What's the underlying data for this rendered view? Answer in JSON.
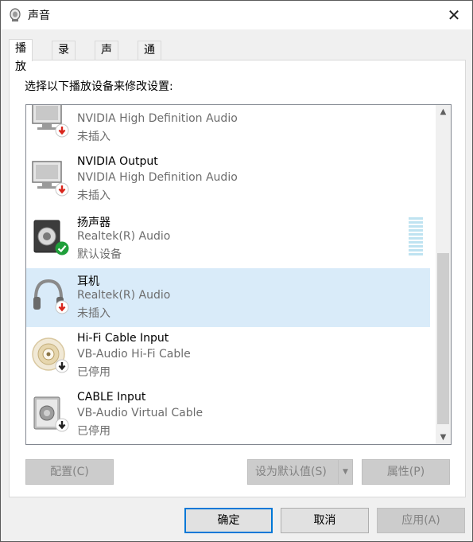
{
  "window": {
    "title": "声音",
    "close_glyph": "✕"
  },
  "tabs": [
    {
      "label": "播放",
      "active": true
    },
    {
      "label": "录制",
      "active": false
    },
    {
      "label": "声音",
      "active": false
    },
    {
      "label": "通信",
      "active": false
    }
  ],
  "playback": {
    "instruction": "选择以下播放设备来修改设置:",
    "devices": [
      {
        "name": "",
        "description": "NVIDIA High Definition Audio",
        "status": "未插入",
        "icon": "monitor-icon",
        "badge": "unplugged-red-arrow",
        "selected": false
      },
      {
        "name": "NVIDIA Output",
        "description": "NVIDIA High Definition Audio",
        "status": "未插入",
        "icon": "monitor-icon",
        "badge": "unplugged-red-arrow",
        "selected": false
      },
      {
        "name": "扬声器",
        "description": "Realtek(R) Audio",
        "status": "默认设备",
        "icon": "speaker-icon",
        "badge": "default-green-check",
        "selected": false
      },
      {
        "name": "耳机",
        "description": "Realtek(R) Audio",
        "status": "未插入",
        "icon": "headphones-icon",
        "badge": "unplugged-red-arrow",
        "selected": true
      },
      {
        "name": "Hi-Fi Cable Input",
        "description": "VB-Audio Hi-Fi Cable",
        "status": "已停用",
        "icon": "cable-icon",
        "badge": "disabled-black-arrow",
        "selected": false
      },
      {
        "name": "CABLE Input",
        "description": "VB-Audio Virtual Cable",
        "status": "已停用",
        "icon": "speaker-box-icon",
        "badge": "disabled-black-arrow",
        "selected": false
      }
    ]
  },
  "scrollbar": {
    "up_glyph": "▲",
    "down_glyph": "▼"
  },
  "buttons": {
    "configure": "配置(C)",
    "set_default": "设为默认值(S)",
    "set_default_arrow": "▼",
    "properties": "属性(P)",
    "ok": "确定",
    "cancel": "取消",
    "apply": "应用(A)"
  },
  "colors": {
    "selection": "#d9ebf9",
    "default_button_border": "#0078d7",
    "status_red": "#d9261c",
    "status_green": "#1f9f3a"
  }
}
